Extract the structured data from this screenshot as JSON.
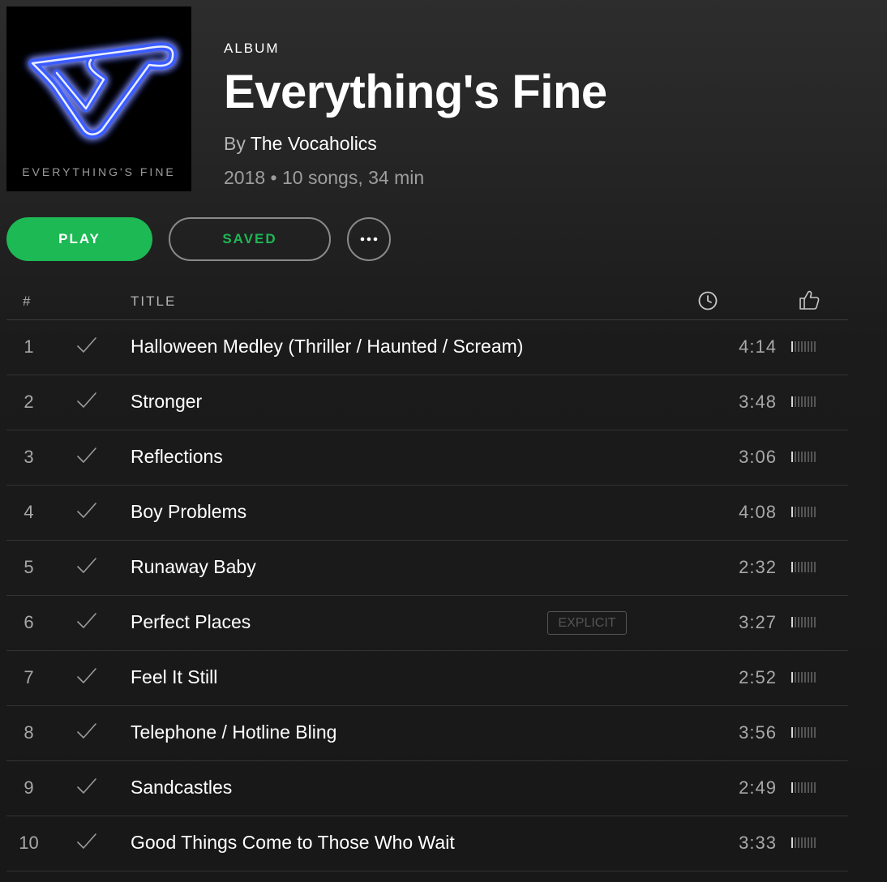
{
  "cover": {
    "text": "EVERYTHING'S FINE"
  },
  "album": {
    "type": "ALBUM",
    "title": "Everything's Fine",
    "by_prefix": "By",
    "artist": "The Vocaholics",
    "meta": "2018 • 10 songs, 34 min"
  },
  "actions": {
    "play_label": "PLAY",
    "saved_label": "SAVED",
    "more_icon": "ellipsis-icon"
  },
  "tracklist": {
    "header": {
      "number": "#",
      "title": "TITLE",
      "duration_icon": "clock-icon",
      "popularity_icon": "thumbs-up-icon"
    },
    "popularity_scale": 8,
    "tracks": [
      {
        "number": "1",
        "title": "Halloween Medley (Thriller / Haunted / Scream)",
        "explicit": "",
        "duration": "4:14",
        "popularity": 1
      },
      {
        "number": "2",
        "title": "Stronger",
        "explicit": "",
        "duration": "3:48",
        "popularity": 1
      },
      {
        "number": "3",
        "title": "Reflections",
        "explicit": "",
        "duration": "3:06",
        "popularity": 1
      },
      {
        "number": "4",
        "title": "Boy Problems",
        "explicit": "",
        "duration": "4:08",
        "popularity": 1
      },
      {
        "number": "5",
        "title": "Runaway Baby",
        "explicit": "",
        "duration": "2:32",
        "popularity": 1
      },
      {
        "number": "6",
        "title": "Perfect Places",
        "explicit": "EXPLICIT",
        "duration": "3:27",
        "popularity": 1
      },
      {
        "number": "7",
        "title": "Feel It Still",
        "explicit": "",
        "duration": "2:52",
        "popularity": 1
      },
      {
        "number": "8",
        "title": "Telephone / Hotline Bling",
        "explicit": "",
        "duration": "3:56",
        "popularity": 1
      },
      {
        "number": "9",
        "title": "Sandcastles",
        "explicit": "",
        "duration": "2:49",
        "popularity": 1
      },
      {
        "number": "10",
        "title": "Good Things Come to Those Who Wait",
        "explicit": "",
        "duration": "3:33",
        "popularity": 1
      }
    ]
  },
  "colors": {
    "accent": "#1db954",
    "background": "#181818",
    "text_primary": "#ffffff",
    "text_secondary": "#a8a8a8"
  }
}
